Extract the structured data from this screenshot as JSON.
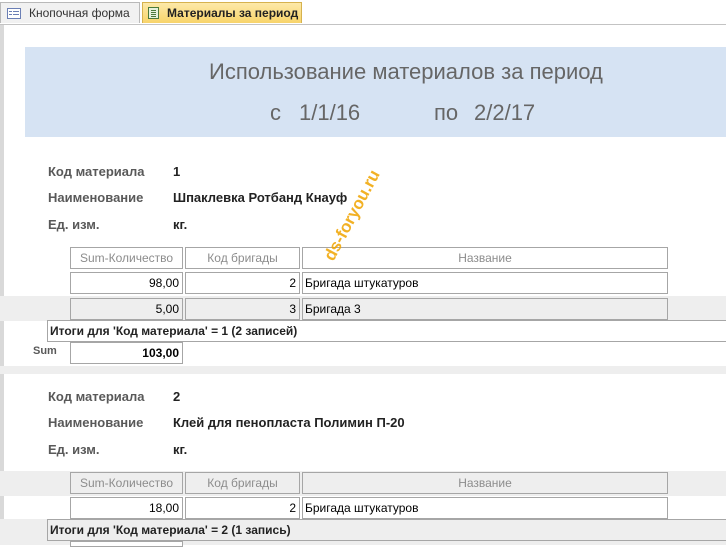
{
  "tabs": [
    {
      "label": "Кнопочная форма"
    },
    {
      "label": "Материалы за период"
    }
  ],
  "report": {
    "title": "Использование материалов за период",
    "from_label": "с",
    "from_date": "1/1/16",
    "to_label": "по",
    "to_date": "2/2/17"
  },
  "labels": {
    "code": "Код материала",
    "name": "Наименование",
    "unit": "Ед. изм.",
    "col_sum": "Sum-Количество",
    "col_brigade": "Код бригады",
    "col_name": "Название",
    "sum": "Sum"
  },
  "groups": [
    {
      "code": "1",
      "name": "Шпаклевка Ротбанд Кнауф",
      "unit": "кг.",
      "rows": [
        {
          "qty": "98,00",
          "brigade": "2",
          "title": "Бригада штукатуров"
        },
        {
          "qty": "5,00",
          "brigade": "3",
          "title": "Бригада 3"
        }
      ],
      "total_text": "Итоги для 'Код материала' = 1 (2 записей)",
      "sum": "103,00"
    },
    {
      "code": "2",
      "name": "Клей для пенопласта Полимин П-20",
      "unit": "кг.",
      "rows": [
        {
          "qty": "18,00",
          "brigade": "2",
          "title": "Бригада штукатуров"
        }
      ],
      "total_text": "Итоги для 'Код материала' = 2 (1 запись)"
    }
  ],
  "watermark": "ds-foryou.ru"
}
